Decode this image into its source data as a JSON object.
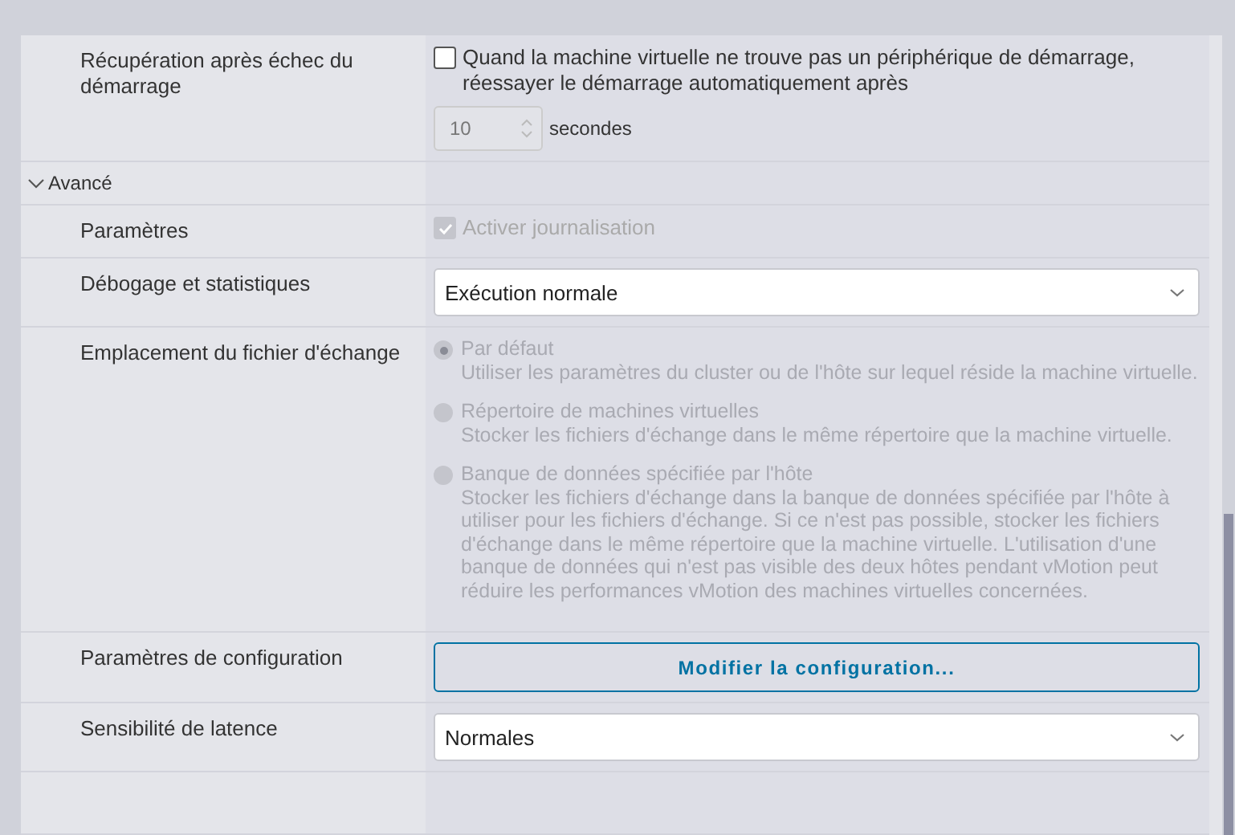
{
  "rows": [
    {
      "kind": "checkbox_spinner",
      "label": "Récupération après échec du démarrage",
      "checkbox": {
        "label": "Quand la machine virtuelle ne trouve pas un périphérique de démarrage, réessayer le démarrage automatiquement après",
        "checked": false,
        "disabled": false
      },
      "spinner": {
        "value": "10",
        "disabled": true
      },
      "unit": "secondes"
    },
    {
      "kind": "section",
      "label": "Avancé",
      "expanded": true
    },
    {
      "kind": "checkbox",
      "label": "Paramètres",
      "checkbox": {
        "label": "Activer journalisation",
        "checked": true,
        "disabled": true
      }
    },
    {
      "kind": "select",
      "label": "Débogage et statistiques",
      "value": "Exécution normale"
    },
    {
      "kind": "radio_group",
      "label": "Emplacement du fichier d'échange",
      "disabled": true,
      "options": [
        {
          "label": "Par défaut",
          "description": "Utiliser les paramètres du cluster ou de l'hôte sur lequel réside la machine virtuelle.",
          "selected": true
        },
        {
          "label": "Répertoire de machines virtuelles",
          "description": "Stocker les fichiers d'échange dans le même répertoire que la machine virtuelle.",
          "selected": false
        },
        {
          "label": "Banque de données spécifiée par l'hôte",
          "description": "Stocker les fichiers d'échange dans la banque de données spécifiée par l'hôte à utiliser pour les fichiers d'échange. Si ce n'est pas possible, stocker les fichiers d'échange dans le même répertoire que la machine virtuelle. L'utilisation d'une banque de données qui n'est pas visible des deux hôtes pendant vMotion peut réduire les performances vMotion des machines virtuelles concernées.",
          "selected": false
        }
      ]
    },
    {
      "kind": "button",
      "label": "Paramètres de configuration",
      "button": "Modifier la configuration..."
    },
    {
      "kind": "select",
      "label": "Sensibilité de latence",
      "value": "Normales"
    }
  ]
}
